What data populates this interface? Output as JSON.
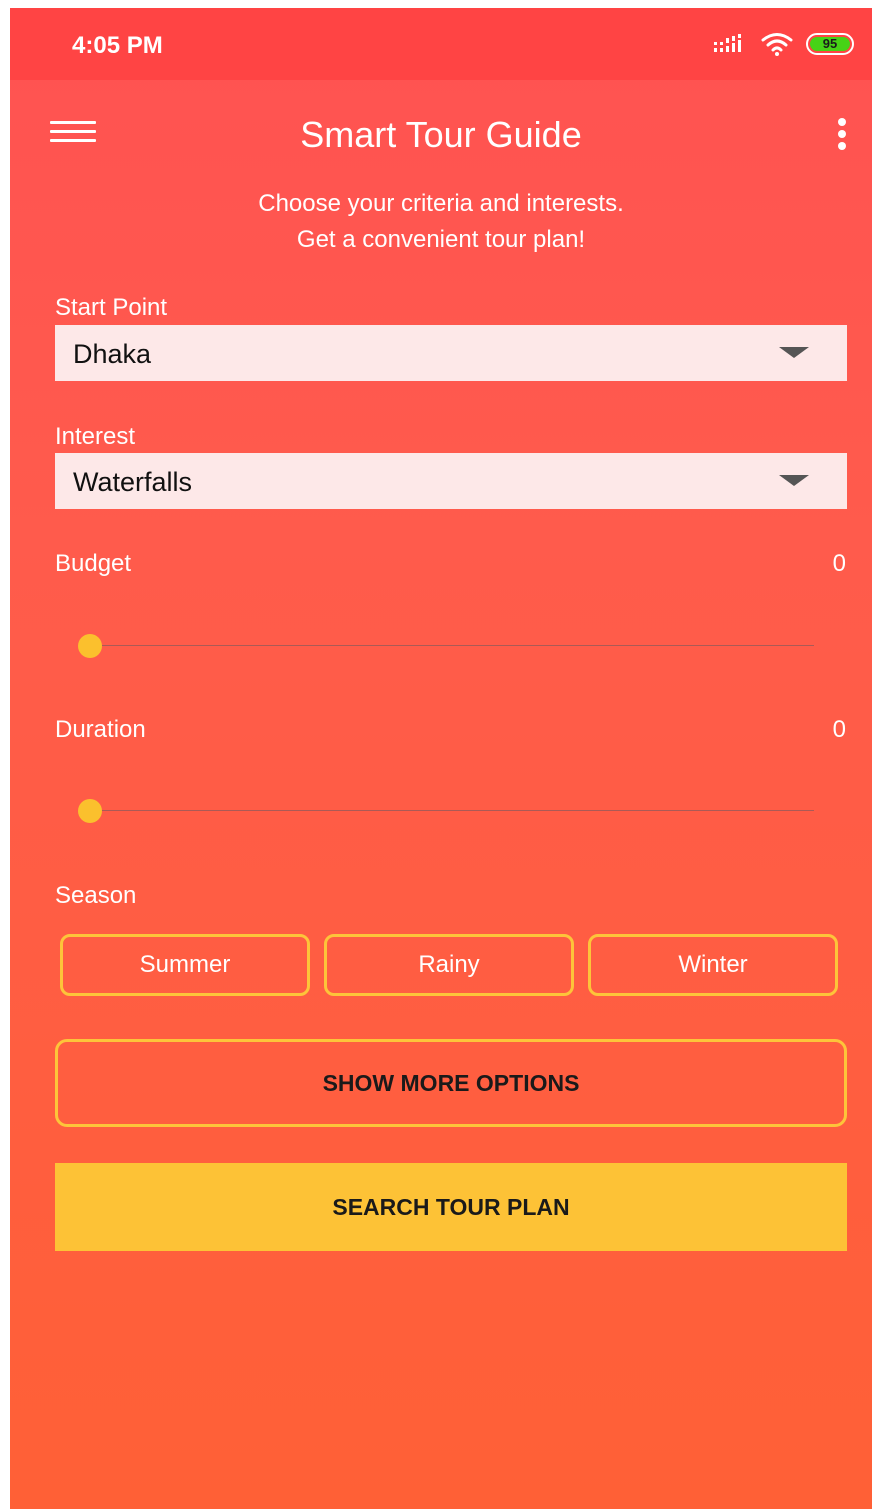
{
  "status_bar": {
    "time": "4:05 PM",
    "battery": "95",
    "icons": [
      "signal-icon",
      "wifi-icon",
      "battery-icon"
    ]
  },
  "toolbar": {
    "title": "Smart Tour Guide",
    "menu_icon": "hamburger-menu-icon",
    "overflow_icon": "more-vert-icon"
  },
  "intro": {
    "line1": "Choose your criteria and interests.",
    "line2": "Get a convenient tour plan!"
  },
  "start_point": {
    "label": "Start Point",
    "value": "Dhaka"
  },
  "interest": {
    "label": "Interest",
    "value": "Waterfalls"
  },
  "budget": {
    "label": "Budget",
    "value": "0",
    "level": 0
  },
  "duration": {
    "label": "Duration",
    "value": "0",
    "level": 0
  },
  "season": {
    "label": "Season",
    "options": [
      "Summer",
      "Rainy",
      "Winter"
    ]
  },
  "actions": {
    "more_options": "SHOW MORE OPTIONS",
    "search": "SEARCH TOUR PLAN"
  },
  "colors": {
    "status_bar": "#ff4444",
    "background_top": "#ff5252",
    "background_bottom": "#ff6036",
    "accent": "#fdc236",
    "dropdown_bg": "#fde8e8"
  }
}
